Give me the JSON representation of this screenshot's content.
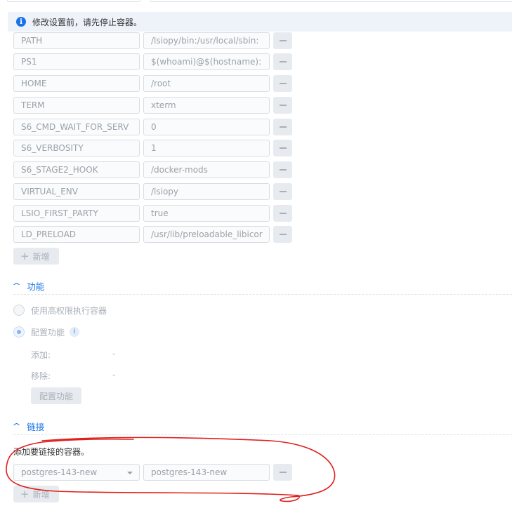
{
  "notice": {
    "text": "修改设置前，请先停止容器。"
  },
  "env_vars": [
    {
      "key": "PATH",
      "value": "/lsiopy/bin:/usr/local/sbin:"
    },
    {
      "key": "PS1",
      "value": "$(whoami)@$(hostname):"
    },
    {
      "key": "HOME",
      "value": "/root"
    },
    {
      "key": "TERM",
      "value": "xterm"
    },
    {
      "key": "S6_CMD_WAIT_FOR_SERV",
      "value": "0"
    },
    {
      "key": "S6_VERBOSITY",
      "value": "1"
    },
    {
      "key": "S6_STAGE2_HOOK",
      "value": "/docker-mods"
    },
    {
      "key": "VIRTUAL_ENV",
      "value": "/lsiopy"
    },
    {
      "key": "LSIO_FIRST_PARTY",
      "value": "true"
    },
    {
      "key": "LD_PRELOAD",
      "value": "/usr/lib/preloadable_libicor"
    }
  ],
  "add_label": "新增",
  "capabilities": {
    "title": "功能",
    "privileged_label": "使用高权限执行容器",
    "configure_label": "配置功能",
    "add_key": "添加:",
    "add_value": "-",
    "remove_key": "移除:",
    "remove_value": "-",
    "configure_button": "配置功能"
  },
  "links": {
    "title": "链接",
    "description": "添加要链接的容器。",
    "container_select": "postgres-143-new",
    "alias_value": "postgres-143-new"
  },
  "colors": {
    "accent": "#1a73e8",
    "annotation": "#e0201b"
  },
  "icons": {
    "info": "i",
    "plus": "+",
    "chevron": "^"
  }
}
